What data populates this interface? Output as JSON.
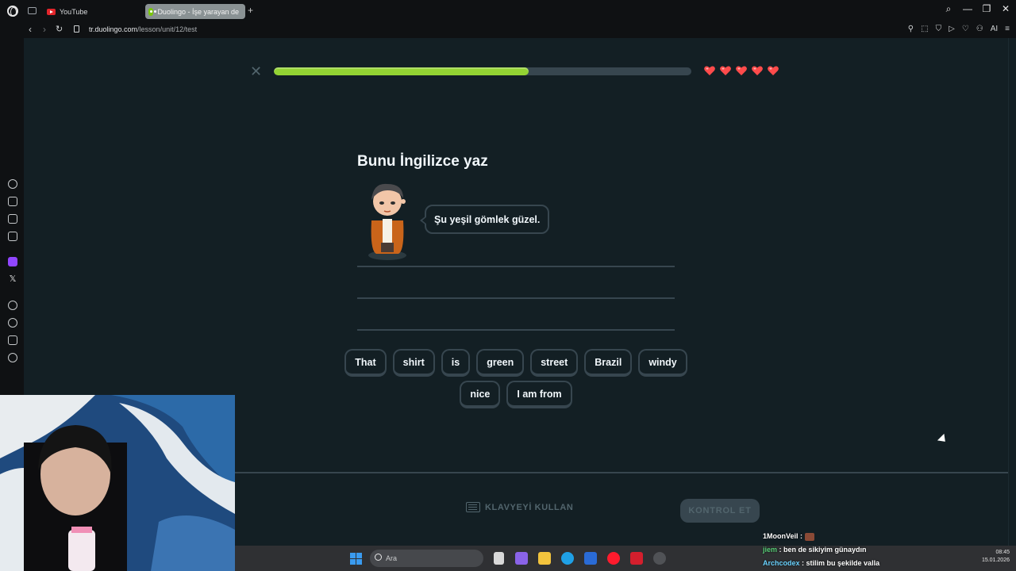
{
  "browser": {
    "tabs": [
      {
        "title": "YouTube",
        "active": false
      },
      {
        "title": "Duolingo - İşe yarayan de",
        "active": true
      }
    ],
    "url_domain": "tr.duolingo.com",
    "url_path": "/lesson/unit/12/test",
    "ai_label": "AI"
  },
  "lesson": {
    "progress_fraction": 0.61,
    "hearts": 5,
    "heart_color": "#ff4b4b",
    "accent_green": "#93d333",
    "title": "Bunu İngilizce yaz",
    "sentence": "Şu yeşil gömlek güzel.",
    "word_bank_rows": [
      [
        "That",
        "shirt",
        "is",
        "green",
        "street",
        "Brazil",
        "windy"
      ],
      [
        "nice",
        "I am from"
      ]
    ],
    "keyboard_label": "KLAVYEYİ KULLAN",
    "check_label": "KONTROL ET"
  },
  "taskbar": {
    "search_placeholder": "Ara",
    "time": "08:45",
    "date": "15.01.2026"
  },
  "chat": [
    {
      "user": "1MoonVeil",
      "message": ""
    },
    {
      "user": "jiem",
      "message": "ben de sikiyim günaydın"
    },
    {
      "user": "Archcodex",
      "message": "stilim bu şekilde valla"
    }
  ]
}
